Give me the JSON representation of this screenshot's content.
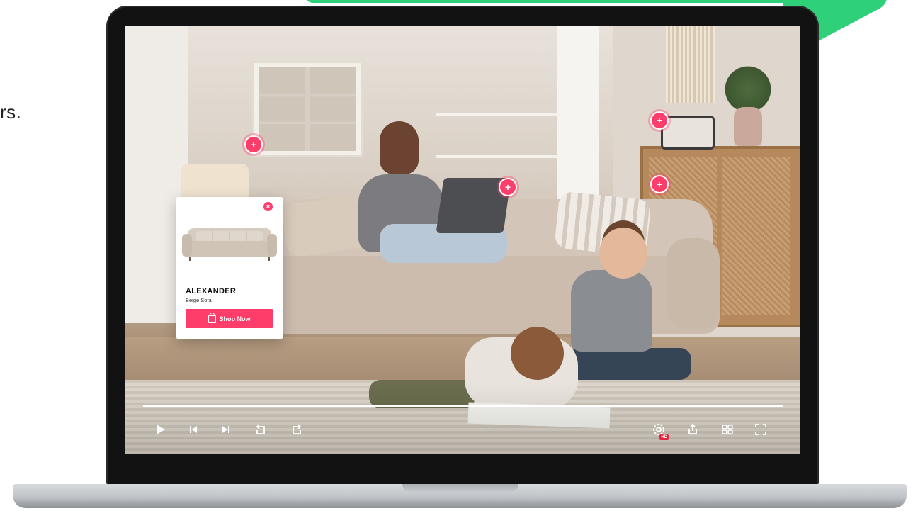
{
  "side_text": "rs.",
  "product_card": {
    "title": "ALEXANDER",
    "subtitle": "Beige Sofa",
    "button_label": "Shop Now",
    "close_glyph": "×",
    "accent_color": "#ff3d6a"
  },
  "hotspots": {
    "glyph": "+",
    "color": "#ff3d6a"
  },
  "player": {
    "progress": 1.0,
    "hd_badge": "HD",
    "icons": [
      "play-icon",
      "skip-previous-icon",
      "skip-next-icon",
      "rewind-icon",
      "forward-icon",
      "settings-icon",
      "share-icon",
      "grid-icon",
      "fullscreen-icon"
    ]
  }
}
